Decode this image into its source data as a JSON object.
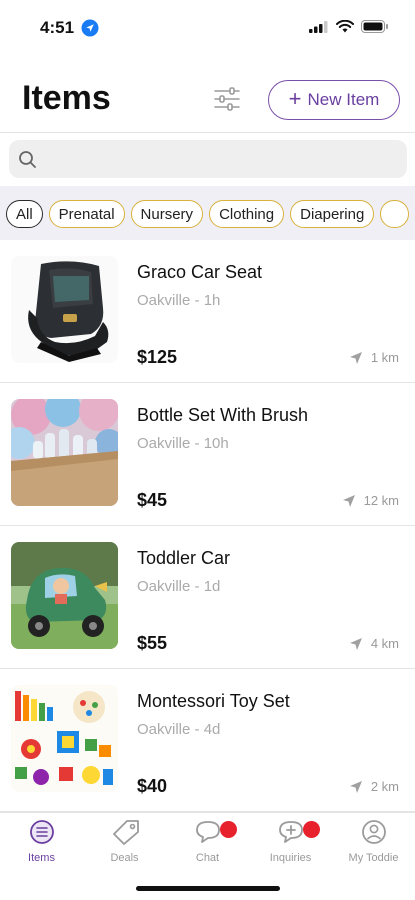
{
  "status_bar": {
    "time": "4:51",
    "icons": [
      "location-arrow-icon",
      "cellular-signal-icon",
      "wifi-icon",
      "battery-icon"
    ]
  },
  "header": {
    "title": "Items",
    "filter_icon": "sliders-icon",
    "new_item_label": "New Item"
  },
  "search": {
    "placeholder": "",
    "value": ""
  },
  "categories": [
    {
      "label": "All",
      "active": true
    },
    {
      "label": "Prenatal",
      "active": false
    },
    {
      "label": "Nursery",
      "active": false
    },
    {
      "label": "Clothing",
      "active": false
    },
    {
      "label": "Diapering",
      "active": false
    }
  ],
  "items": [
    {
      "title": "Graco Car Seat",
      "location": "Oakville",
      "age": "1h",
      "price": "$125",
      "distance": "1 km",
      "image": "car-seat-photo"
    },
    {
      "title": "Bottle Set With Brush",
      "location": "Oakville",
      "age": "10h",
      "price": "$45",
      "distance": "12 km",
      "image": "bottle-set-photo"
    },
    {
      "title": "Toddler Car",
      "location": "Oakville",
      "age": "1d",
      "price": "$55",
      "distance": "4 km",
      "image": "toddler-car-photo"
    },
    {
      "title": "Montessori Toy Set",
      "location": "Oakville",
      "age": "4d",
      "price": "$40",
      "distance": "2 km",
      "image": "toy-set-photo"
    }
  ],
  "tabs": [
    {
      "label": "Items",
      "icon": "items-list-icon",
      "active": true,
      "badge": false
    },
    {
      "label": "Deals",
      "icon": "tag-icon",
      "active": false,
      "badge": false
    },
    {
      "label": "Chat",
      "icon": "chat-bubble-icon",
      "active": false,
      "badge": true
    },
    {
      "label": "Inquiries",
      "icon": "inquiry-bubble-icon",
      "active": false,
      "badge": true
    },
    {
      "label": "My Toddie",
      "icon": "profile-icon",
      "active": false,
      "badge": false
    }
  ],
  "colors": {
    "accent": "#6a3fa0",
    "chip_border": "#d8b23c",
    "badge": "#e8222c",
    "muted": "#aaaaaa"
  }
}
